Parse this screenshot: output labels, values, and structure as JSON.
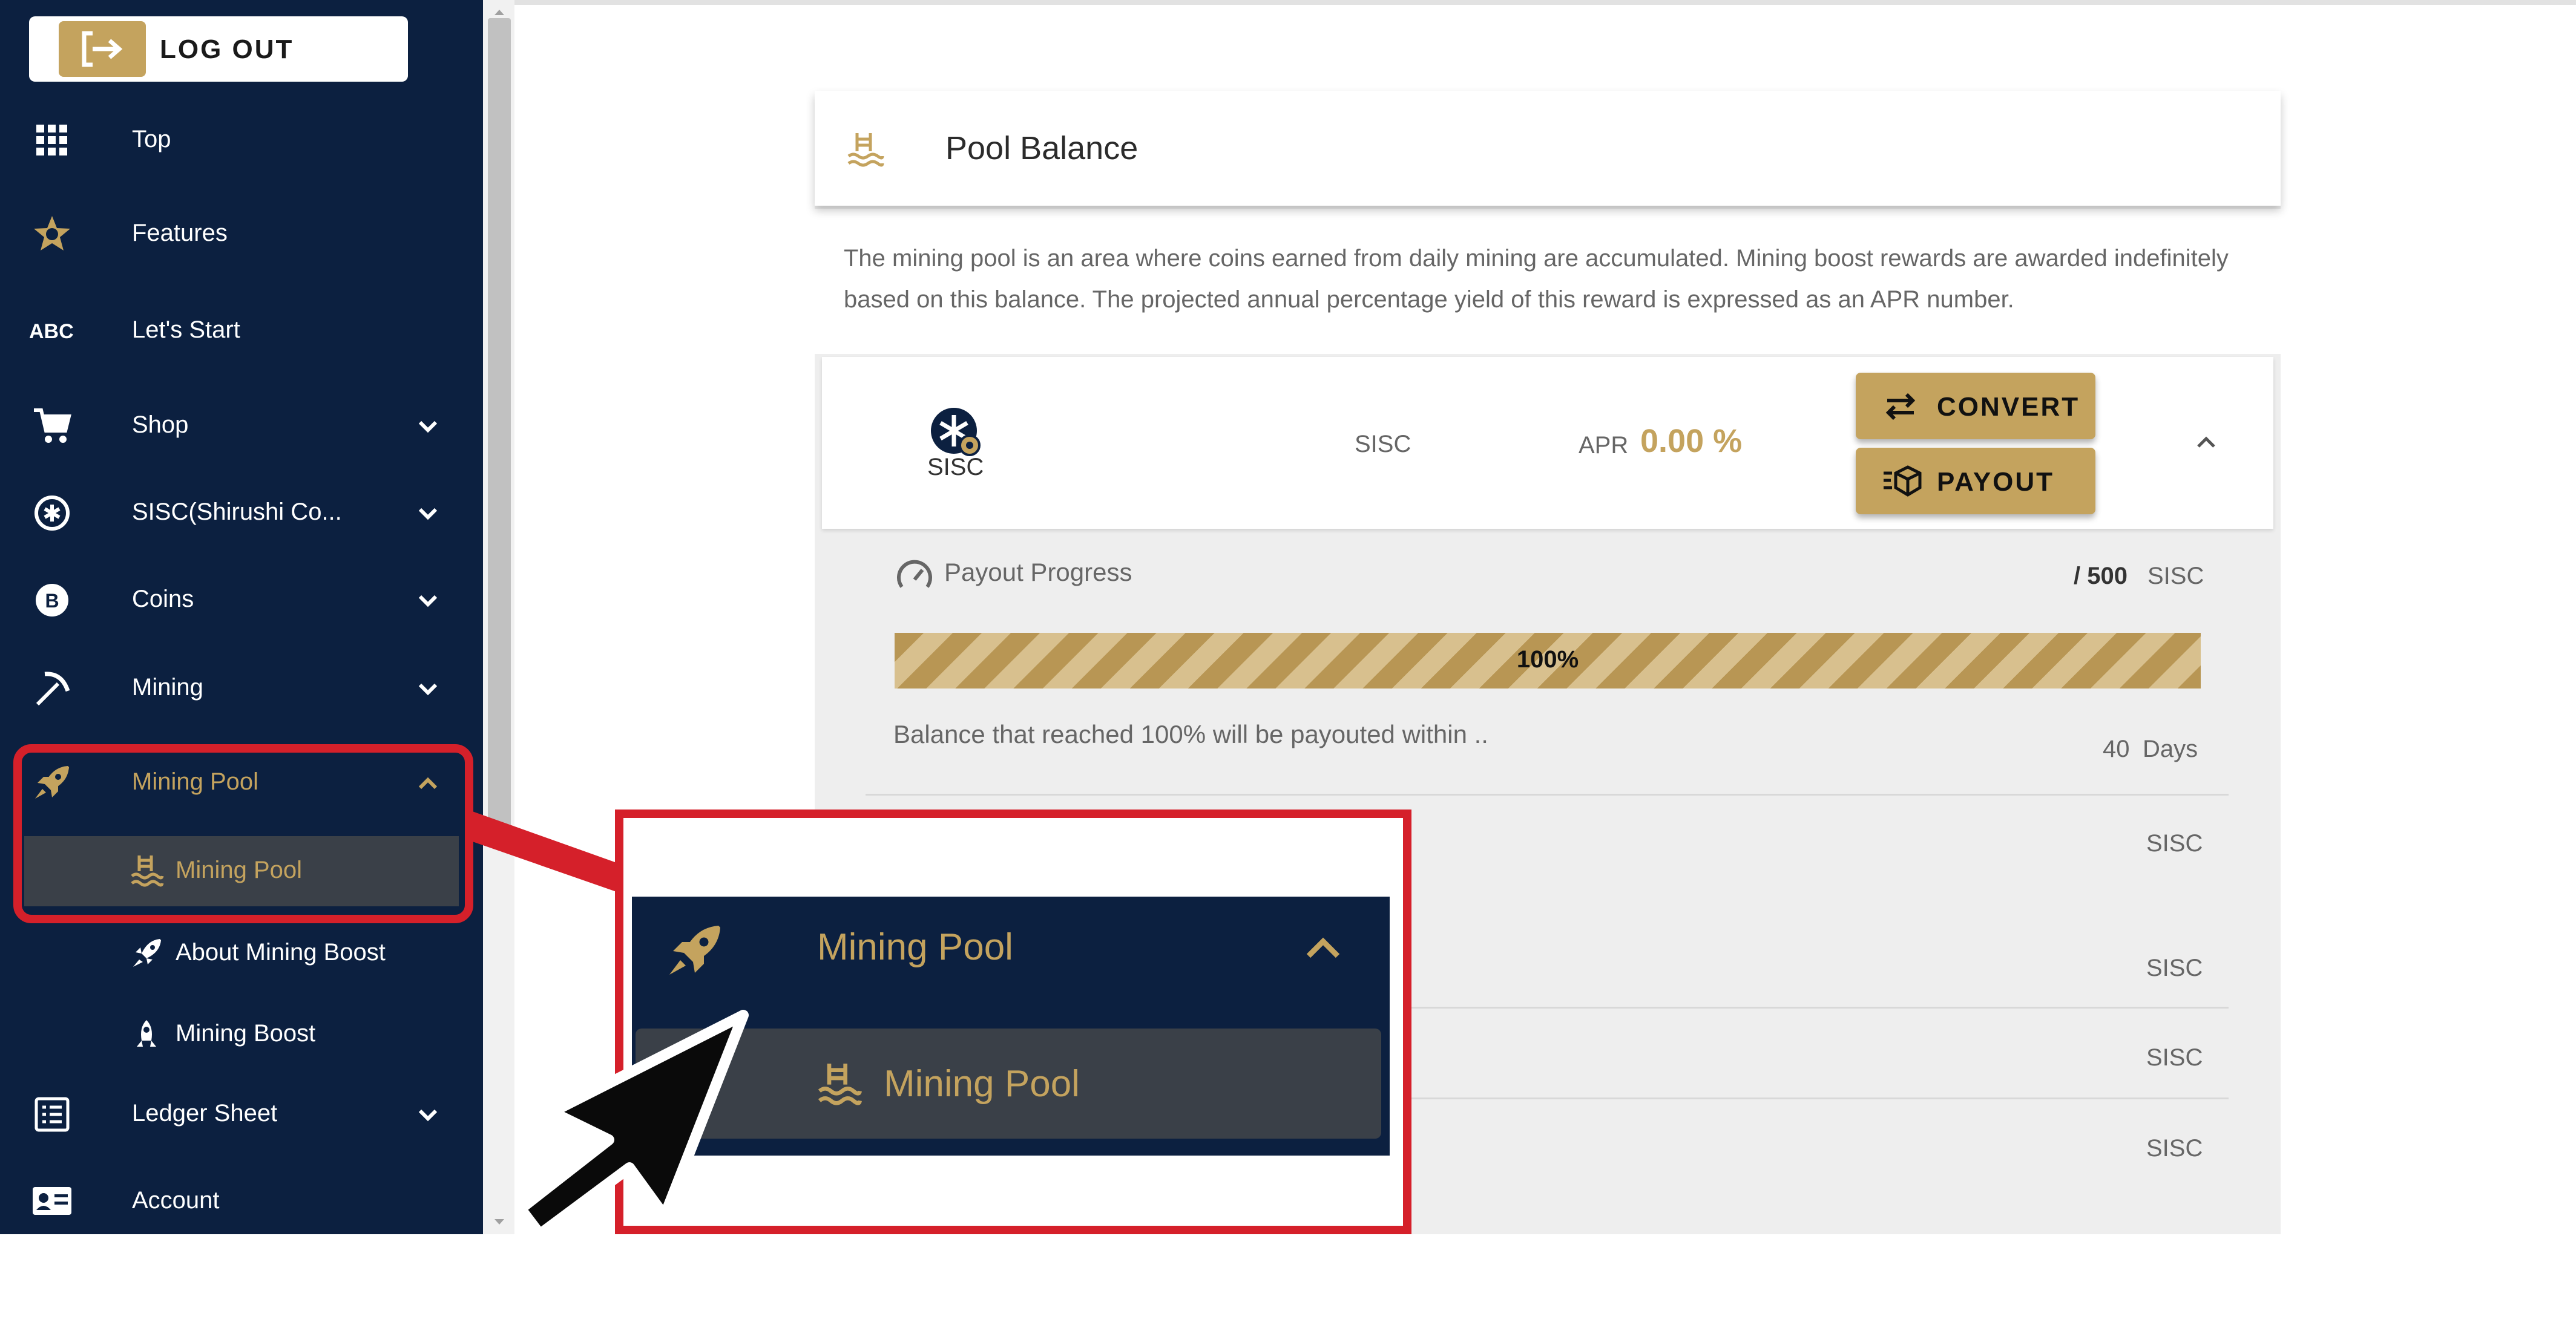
{
  "sidebar": {
    "logout_label": "LOG OUT",
    "items": [
      {
        "label": "Top",
        "icon": "grid-icon"
      },
      {
        "label": "Features",
        "icon": "star-icon"
      },
      {
        "label": "Let's Start",
        "icon": "abc-icon"
      },
      {
        "label": "Shop",
        "icon": "cart-icon"
      },
      {
        "label": "SISC(Shirushi Co...",
        "icon": "asterisk-coin-icon"
      },
      {
        "label": "Coins",
        "icon": "bitcoin-icon"
      },
      {
        "label": "Mining",
        "icon": "pickaxe-icon"
      },
      {
        "label": "Mining Pool",
        "icon": "rocket-icon"
      },
      {
        "label": "Ledger Sheet",
        "icon": "list-icon"
      },
      {
        "label": "Account",
        "icon": "id-card-icon"
      }
    ],
    "sub_items": [
      {
        "label": "Mining Pool",
        "icon": "pool-icon"
      },
      {
        "label": "About Mining Boost",
        "icon": "rocket-icon"
      },
      {
        "label": "Mining Boost",
        "icon": "rocket-small-icon"
      }
    ]
  },
  "pool": {
    "title": "Pool Balance",
    "intro": "The mining pool is an area where coins earned from daily mining are accumulated. Mining boost rewards are awarded indefinitely based on this balance. The projected annual percentage yield of this reward is expressed as an APR number.",
    "coin_icon_label": "SISC",
    "coin_name": "SISC",
    "apr_label": "APR",
    "apr_value": "0.00 %",
    "convert_label": "CONVERT",
    "payout_label": "PAYOUT",
    "progress_label": "Payout Progress",
    "progress_target": "/ 500",
    "progress_unit": "SISC",
    "progress_percent_text": "100%",
    "progress_fraction": 1.0,
    "balance_note": "Balance that reached 100% will be payouted within ..",
    "days_value": "40",
    "days_unit": "Days",
    "rows": [
      {
        "unit": "SISC"
      },
      {
        "unit": "SISC"
      },
      {
        "unit": "SISC"
      },
      {
        "unit": "SISC"
      }
    ]
  },
  "zoom": {
    "menu_label": "Mining Pool",
    "sub_label": "Mining Pool"
  },
  "colors": {
    "navy": "#0c2040",
    "gold": "#c4a35e",
    "highlight_red": "#d5202a",
    "active_bg": "#3a4048"
  }
}
